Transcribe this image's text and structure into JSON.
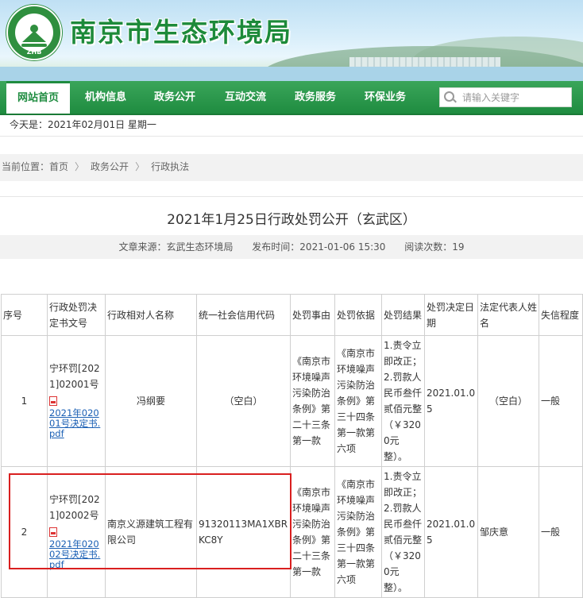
{
  "header": {
    "site_title": "南京市生态环境局",
    "logo_text": "ZHB",
    "brand_color": "#1f8c40",
    "search": {
      "placeholder": "请输入关键字",
      "icon": "search-icon"
    }
  },
  "nav": {
    "items": [
      {
        "label": "网站首页",
        "active": true
      },
      {
        "label": "机构信息"
      },
      {
        "label": "政务公开"
      },
      {
        "label": "互动交流"
      },
      {
        "label": "政务服务"
      },
      {
        "label": "环保业务"
      }
    ]
  },
  "datebar": {
    "text": "今天是：2021年02月01日 星期一"
  },
  "breadcrumb": {
    "prefix": "当前位置：",
    "items": [
      "首页",
      "政务公开",
      "行政执法"
    ],
    "separator": "〉"
  },
  "article": {
    "title": "2021年1月25日行政处罚公开（玄武区）",
    "source": "文章来源：玄武生态环境局",
    "published": "发布时间：2021-01-06 15:30",
    "views": "阅读次数：19"
  },
  "table": {
    "headers": [
      "序号",
      "行政处罚决定书文号",
      "行政相对人名称",
      "统一社会信用代码",
      "处罚事由",
      "处罚依据",
      "处罚结果",
      "处罚决定日期",
      "法定代表人姓名",
      "失信程度"
    ],
    "rows": [
      {
        "no": "1",
        "doc_no": "宁环罚[2021]02001号",
        "attachment": "2021年02001号决定书.pdf",
        "party": "冯纲要",
        "credit_code": "（空白）",
        "reason": "《南京市环境噪声污染防治条例》第二十三条第一款",
        "basis": "《南京市环境噪声污染防治条例》第三十四条第一款第六项",
        "result": "1.责令立即改正；2.罚款人民币叁仟贰佰元整（￥3200元整）。",
        "date": "2021.01.05",
        "legal_rep": "（空白）",
        "credit_level": "一般"
      },
      {
        "no": "2",
        "doc_no": "宁环罚[2021]02002号",
        "attachment": "2021年02002号决定书.pdf",
        "party": "南京义源建筑工程有限公司",
        "credit_code": "91320113MA1XBRKC8Y",
        "reason": "《南京市环境噪声污染防治条例》第二十三条第一款",
        "basis": "《南京市环境噪声污染防治条例》第三十四条第一款第六项",
        "result": "1.责令立即改正；2.罚款人民币叁仟贰佰元整（￥3200元整）。",
        "date": "2021.01.05",
        "legal_rep": "邹庆意",
        "credit_level": "一般"
      }
    ]
  },
  "annotation": {
    "highlight_color": "#d91f1f"
  }
}
